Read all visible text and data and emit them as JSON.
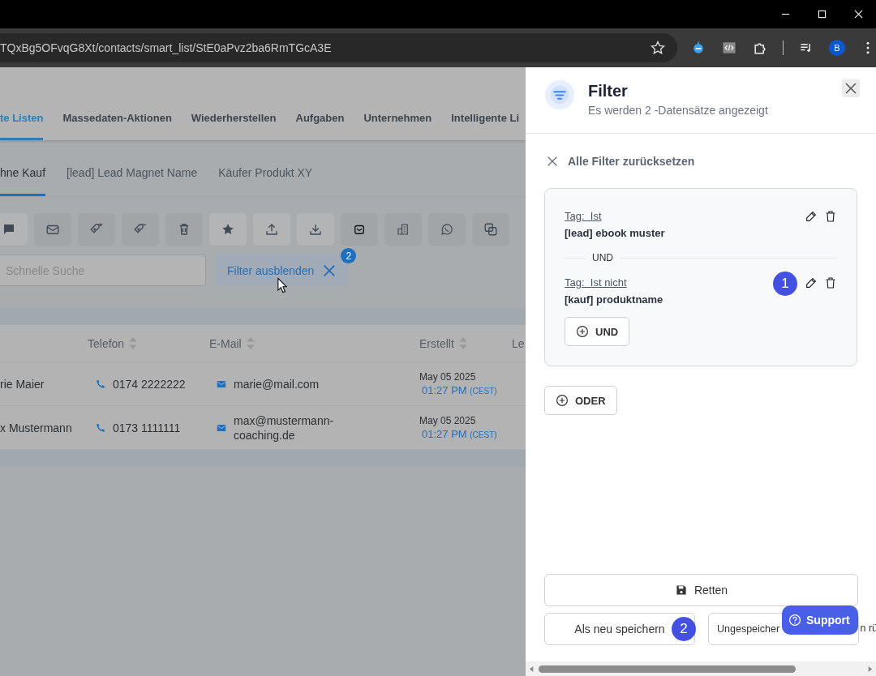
{
  "browser": {
    "url": "TQxBg5OFvqG8Xt/contacts/smart_list/StE0aPvz2ba6RmTGcA3E",
    "profile_initial": "B"
  },
  "nav_tabs": [
    {
      "label": "te Listen",
      "selected": true
    },
    {
      "label": "Massedaten-Aktionen",
      "selected": false
    },
    {
      "label": "Wiederherstellen",
      "selected": false
    },
    {
      "label": "Aufgaben",
      "selected": false
    },
    {
      "label": "Unternehmen",
      "selected": false
    },
    {
      "label": "Intelligente Li",
      "selected": false
    }
  ],
  "list_tabs": [
    {
      "label": "hne Kauf",
      "selected": true
    },
    {
      "label": "[lead] Lead Magnet Name",
      "selected": false
    },
    {
      "label": "Käufer Produkt XY",
      "selected": false
    }
  ],
  "toolbar": [
    {
      "kind": "message"
    },
    {
      "kind": "mail"
    },
    {
      "kind": "tag-add"
    },
    {
      "kind": "tag-remove"
    },
    {
      "kind": "trash"
    },
    {
      "kind": "star"
    },
    {
      "kind": "upload"
    },
    {
      "kind": "download"
    },
    {
      "kind": "inbox"
    },
    {
      "kind": "building"
    },
    {
      "kind": "whatsapp"
    },
    {
      "kind": "copy"
    }
  ],
  "search": {
    "placeholder": "Schnelle Suche"
  },
  "filter_button": {
    "label": "Filter ausblenden",
    "badge": "2"
  },
  "table": {
    "columns": [
      "",
      "Telefon",
      "E-Mail",
      "Erstellt",
      "Le"
    ],
    "rows": [
      {
        "name": "rie Maier",
        "phone": "0174 2222222",
        "email": "marie@mail.com",
        "date": "May 05 2025",
        "time": "01:27 PM",
        "zone": "(CEST)"
      },
      {
        "name": "x Mustermann",
        "phone": "0173 1111111",
        "email": "max@mustermann-coaching.de",
        "date": "May 05 2025",
        "time": "01:27 PM",
        "zone": "(CEST)"
      }
    ]
  },
  "filter_panel": {
    "title": "Filter",
    "subtitle": "Es werden 2 -Datensätze angezeigt",
    "reset_label": "Alle Filter zurücksetzen",
    "conditions": [
      {
        "field": "Tag:  Ist",
        "value": "[lead] ebook muster"
      },
      {
        "field": "Tag:  Ist nicht",
        "value": "[kauf] produktname"
      }
    ],
    "connector": "UND",
    "add_and_label": "UND",
    "add_or_label": "ODER",
    "save_label": "Retten",
    "save_new_label": "Als neu speichern",
    "discard_label_start": "Ungespeicher",
    "discard_label_end": "n rü",
    "step_markers": [
      "1",
      "2"
    ]
  },
  "support": {
    "label": "Support"
  }
}
